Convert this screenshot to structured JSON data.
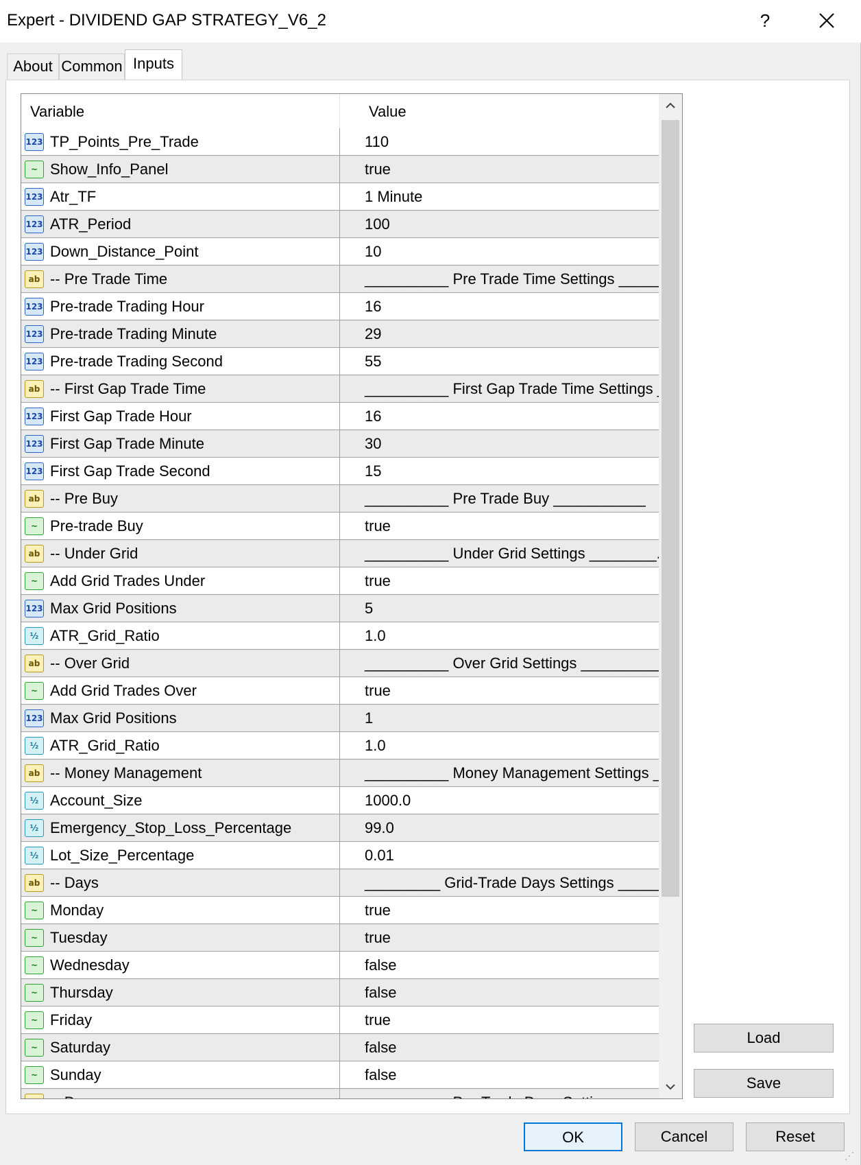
{
  "window": {
    "title": "Expert - DIVIDEND GAP STRATEGY_V6_2",
    "help_label": "?"
  },
  "tabs": [
    {
      "label": "About",
      "active": false
    },
    {
      "label": "Common",
      "active": false
    },
    {
      "label": "Inputs",
      "active": true
    }
  ],
  "grid": {
    "columns": {
      "variable": "Variable",
      "value": "Value"
    },
    "rows": [
      {
        "type": "int",
        "variable": "TP_Points_Pre_Trade",
        "value": "110"
      },
      {
        "type": "bool",
        "variable": "Show_Info_Panel",
        "value": "true"
      },
      {
        "type": "int",
        "variable": "Atr_TF",
        "value": "1 Minute"
      },
      {
        "type": "int",
        "variable": "ATR_Period",
        "value": "100"
      },
      {
        "type": "int",
        "variable": "Down_Distance_Point",
        "value": "10"
      },
      {
        "type": "str",
        "variable": "-- Pre Trade Time",
        "value": "__________ Pre Trade Time Settings _____..."
      },
      {
        "type": "int",
        "variable": "Pre-trade Trading Hour",
        "value": "16"
      },
      {
        "type": "int",
        "variable": "Pre-trade Trading Minute",
        "value": "29"
      },
      {
        "type": "int",
        "variable": "Pre-trade Trading Second",
        "value": "55"
      },
      {
        "type": "str",
        "variable": "-- First Gap Trade Time",
        "value": "__________ First Gap Trade Time Settings _..."
      },
      {
        "type": "int",
        "variable": "First Gap Trade Hour",
        "value": "16"
      },
      {
        "type": "int",
        "variable": "First Gap Trade Minute",
        "value": "30"
      },
      {
        "type": "int",
        "variable": "First Gap Trade Second",
        "value": "15"
      },
      {
        "type": "str",
        "variable": "-- Pre Buy",
        "value": "__________ Pre Trade Buy ___________"
      },
      {
        "type": "bool",
        "variable": "Pre-trade Buy",
        "value": "true"
      },
      {
        "type": "str",
        "variable": "-- Under Grid",
        "value": "__________ Under Grid  Settings ________..."
      },
      {
        "type": "bool",
        "variable": "Add Grid Trades Under",
        "value": "true"
      },
      {
        "type": "int",
        "variable": "Max Grid Positions",
        "value": "5"
      },
      {
        "type": "dbl",
        "variable": "ATR_Grid_Ratio",
        "value": "1.0"
      },
      {
        "type": "str",
        "variable": "-- Over Grid",
        "value": "__________ Over Grid  Settings ___________"
      },
      {
        "type": "bool",
        "variable": "Add Grid Trades Over",
        "value": "true"
      },
      {
        "type": "int",
        "variable": "Max Grid Positions",
        "value": "1"
      },
      {
        "type": "dbl",
        "variable": "ATR_Grid_Ratio",
        "value": "1.0"
      },
      {
        "type": "str",
        "variable": "-- Money Management",
        "value": "__________ Money Management  Settings _..."
      },
      {
        "type": "dbl",
        "variable": "Account_Size",
        "value": "1000.0"
      },
      {
        "type": "dbl",
        "variable": "Emergency_Stop_Loss_Percentage",
        "value": "99.0"
      },
      {
        "type": "dbl",
        "variable": "Lot_Size_Percentage",
        "value": "0.01"
      },
      {
        "type": "str",
        "variable": "-- Days",
        "value": "_________ Grid-Trade Days Settings _____..."
      },
      {
        "type": "bool",
        "variable": "Monday",
        "value": "true"
      },
      {
        "type": "bool",
        "variable": "Tuesday",
        "value": "true"
      },
      {
        "type": "bool",
        "variable": "Wednesday",
        "value": "false"
      },
      {
        "type": "bool",
        "variable": "Thursday",
        "value": "false"
      },
      {
        "type": "bool",
        "variable": "Friday",
        "value": "true"
      },
      {
        "type": "bool",
        "variable": "Saturday",
        "value": "false"
      },
      {
        "type": "bool",
        "variable": "Sunday",
        "value": "false"
      },
      {
        "type": "str",
        "variable": "-- Days",
        "value": "__________ Pre-Trade Days Setti..."
      }
    ]
  },
  "icons": {
    "int": "123",
    "bool": "~",
    "str": "ab",
    "dbl": "½"
  },
  "side_buttons": {
    "load": "Load",
    "save": "Save"
  },
  "bottom_buttons": {
    "ok": "OK",
    "cancel": "Cancel",
    "reset": "Reset"
  }
}
